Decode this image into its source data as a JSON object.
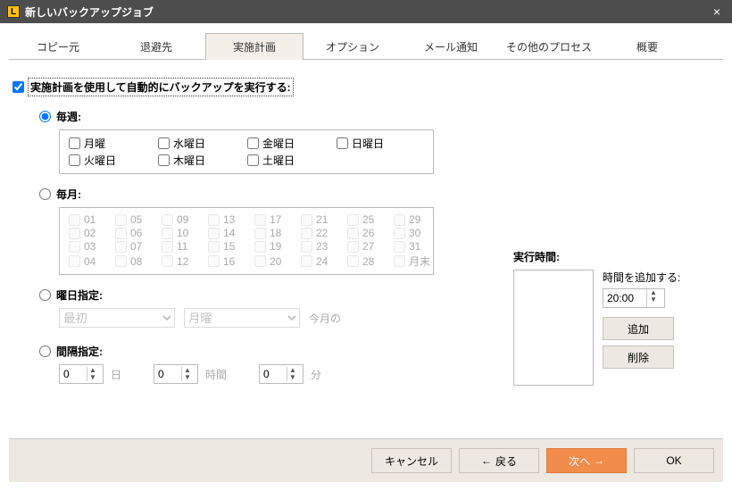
{
  "window": {
    "title": "新しいバックアップジョブ",
    "close": "×"
  },
  "tabs": {
    "src": "コピー元",
    "dest": "退避先",
    "schedule": "実施計画",
    "options": "オプション",
    "mail": "メール通知",
    "other": "その他のプロセス",
    "summary": "概要"
  },
  "master_check": {
    "checked": true,
    "label": "実施計画を使用して自動的にバックアップを実行する:"
  },
  "weekly": {
    "label": "毎週:",
    "days": {
      "mon": "月曜",
      "tue": "火曜日",
      "wed": "水曜日",
      "thu": "木曜日",
      "fri": "金曜日",
      "sat": "土曜日",
      "sun": "日曜日"
    }
  },
  "monthly": {
    "label": "毎月:",
    "days": [
      "01",
      "02",
      "03",
      "04",
      "05",
      "06",
      "07",
      "08",
      "09",
      "10",
      "11",
      "12",
      "13",
      "14",
      "15",
      "16",
      "17",
      "18",
      "19",
      "20",
      "21",
      "22",
      "23",
      "24",
      "25",
      "26",
      "27",
      "28",
      "29",
      "30",
      "31"
    ],
    "month_end": "月末"
  },
  "weekday_spec": {
    "label": "曜日指定:",
    "first": "最初",
    "day": "月曜",
    "suffix": "今月の"
  },
  "interval": {
    "label": "間隔指定:",
    "days_val": "0",
    "days_lbl": "日",
    "hours_val": "0",
    "hours_lbl": "時間",
    "mins_val": "0",
    "mins_lbl": "分"
  },
  "runtime": {
    "header": "実行時間:",
    "add_time_label": "時間を追加する:",
    "time_value": "20:00",
    "add_btn": "追加",
    "del_btn": "削除"
  },
  "footer": {
    "cancel": "キャンセル",
    "back": "戻る",
    "next": "次へ",
    "ok": "OK"
  }
}
